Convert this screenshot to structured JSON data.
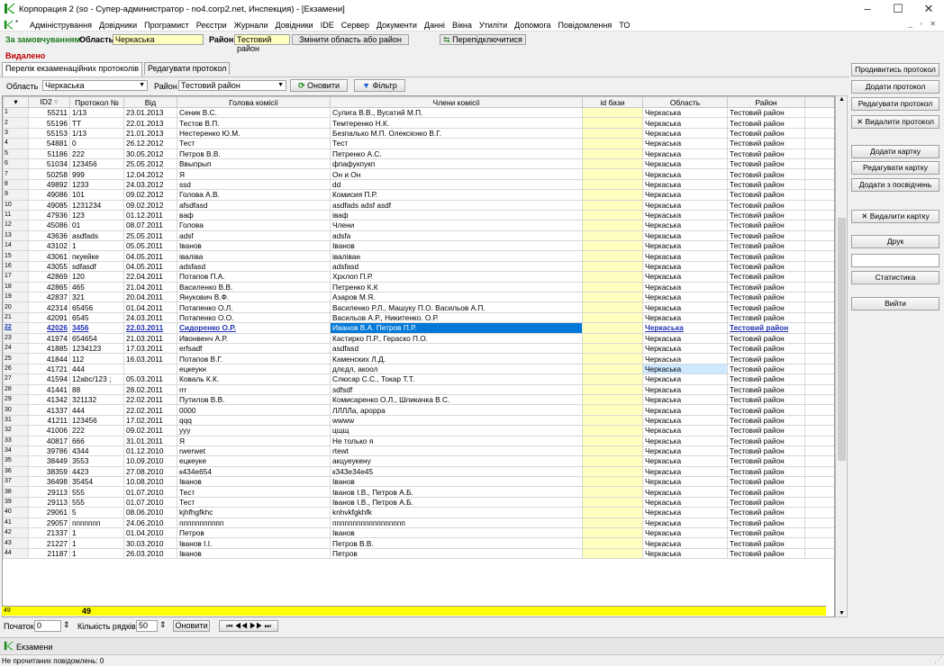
{
  "window": {
    "title": "Корпорация 2 (so - Супер-администратор - no4.corp2.net, Инспекция) - [Екзамени]"
  },
  "menu": [
    "Адміністрування",
    "Довідники",
    "Програмист",
    "Реєстри",
    "Журнали",
    "Довідники",
    "IDE",
    "Сервер",
    "Документи",
    "Данні",
    "Вікна",
    "Утиліти",
    "Допомога",
    "Повідомлення",
    "ТО"
  ],
  "order": {
    "label": "За замовчуванням:",
    "region_label": "Область",
    "region_value": "Черкаська",
    "district_label": "Район",
    "district_value": "Тестовий район",
    "change_btn": "Змінити область або район",
    "reconnect_btn": "Перепідключитися"
  },
  "deleted_label": "Видалено",
  "tabs": [
    "Перелік екзаменаційних протоколів",
    "Редагувати протокол"
  ],
  "filter": {
    "region_label": "Область",
    "region_value": "Черкаська",
    "district_label": "Район",
    "district_value": "Тестовий район",
    "refresh_btn": "Оновити",
    "filter_btn": "Фільтр"
  },
  "columns": [
    "ID2",
    "Протокол №",
    "Від",
    "Голова комісії",
    "Члени комісії",
    "id бази",
    "Область",
    "Район"
  ],
  "rows": [
    [
      "1",
      "55211",
      "1/13",
      "23.01.2013",
      "Сеник В.С.",
      "Сулига В.В., Вусатий М.П.",
      "",
      "Черкаська",
      "Тестовий район"
    ],
    [
      "2",
      "55196",
      "ТТ",
      "22.01.2013",
      "Тестов В.П.",
      "Темтеренко Н.К.",
      "",
      "Черкаська",
      "Тестовий район"
    ],
    [
      "3",
      "55153",
      "1/13",
      "21.01.2013",
      "Нестеренко Ю.М.",
      "Безпалько М.П. Олексієнко В.Г.",
      "",
      "Черкаська",
      "Тестовий район"
    ],
    [
      "4",
      "54881",
      "0",
      "26.12.2012",
      "Тест",
      "Тест",
      "",
      "Черкаська",
      "Тестовий район"
    ],
    [
      "5",
      "51186",
      "222",
      "30.05.2012",
      "Петров В.В.",
      "Петренко А.С.",
      "",
      "Черкаська",
      "Тестовий район"
    ],
    [
      "6",
      "51034",
      "123456",
      "25.05.2012",
      "Ввыпрып",
      "фпафукпукп",
      "",
      "Черкаська",
      "Тестовий район"
    ],
    [
      "7",
      "50258",
      "999",
      "12.04.2012",
      "Я",
      "Он и Он",
      "",
      "Черкаська",
      "Тестовий район"
    ],
    [
      "8",
      "49892",
      "1233",
      "24.03.2012",
      "ssd",
      "dd",
      "",
      "Черкаська",
      "Тестовий район"
    ],
    [
      "9",
      "49086",
      "101",
      "09.02.2012",
      "Голова А.В.",
      "Комисия П.Р.",
      "",
      "Черкаська",
      "Тестовий район"
    ],
    [
      "10",
      "49085",
      "1231234",
      "09.02.2012",
      "afsdfasd",
      "asdfads adsf asdf",
      "",
      "Черкаська",
      "Тестовий район"
    ],
    [
      "11",
      "47936",
      "123",
      "01.12.2011",
      "ваф",
      "іваф",
      "",
      "Черкаська",
      "Тестовий район"
    ],
    [
      "12",
      "45086",
      "01",
      "08.07.2011",
      "Голова",
      "Члени",
      "",
      "Черкаська",
      "Тестовий район"
    ],
    [
      "13",
      "43636",
      "asdfads",
      "25.05.2011",
      "adsf",
      "adsfa",
      "",
      "Черкаська",
      "Тестовий район"
    ],
    [
      "14",
      "43102",
      "1",
      "05.05.2011",
      "Іванов",
      "Іванов",
      "",
      "Черкаська",
      "Тестовий район"
    ],
    [
      "15",
      "43061",
      "пкуейке",
      "04.05.2011",
      "іваліва",
      "іваліван",
      "",
      "Черкаська",
      "Тестовий район"
    ],
    [
      "16",
      "43055",
      "sdfasdf",
      "04.05.2011",
      "adsfasd",
      "adsfasd",
      "",
      "Черкаська",
      "Тестовий район"
    ],
    [
      "17",
      "42869",
      "120",
      "22.04.2011",
      "Потапов П.А.",
      "Хрхлоп П.Р.",
      "",
      "Черкаська",
      "Тестовий район"
    ],
    [
      "18",
      "42865",
      "465",
      "21.04.2011",
      "Василенко В.В.",
      "Петренко К.К",
      "",
      "Черкаська",
      "Тестовий район"
    ],
    [
      "19",
      "42837",
      "321",
      "20.04.2011",
      "Янукович В.Ф.",
      "Азаров М.Я.",
      "",
      "Черкаська",
      "Тестовий район"
    ],
    [
      "20",
      "42314",
      "65456",
      "01.04.2011",
      "Потапенко О.Л.",
      "Василенко Р.Л., Машуку П.О. Васильов А.П.",
      "",
      "Черкаська",
      "Тестовий район"
    ],
    [
      "21",
      "42091",
      "6545",
      "24.03.2011",
      "Потапенко О.О.",
      "Васильов А.Р., Никитенко. О.Р.",
      "",
      "Черкаська",
      "Тестовий район"
    ],
    [
      "22",
      "42026",
      "3456",
      "22.03.2011",
      "Сидоренко О.Р.",
      "Иванов В.А. Петров П.Р.",
      "",
      "Черкаська",
      "Тестовий район"
    ],
    [
      "23",
      "41974",
      "654654",
      "21.03.2011",
      "Ивонвенч А.Р.",
      "Кастирко П.Р., Гераско П.О.",
      "",
      "Черкаська",
      "Тестовий район"
    ],
    [
      "24",
      "41885",
      "1234123",
      "17.03.2011",
      "erfsadf",
      "asdfasd",
      "",
      "Черкаська",
      "Тестовий район"
    ],
    [
      "25",
      "41844",
      "112",
      "16.03.2011",
      "Потапов В.Г.",
      "Каменских Л.Д.",
      "",
      "Черкаська",
      "Тестовий район"
    ],
    [
      "26",
      "41721",
      "444",
      "",
      "ецкеукн",
      "длєдл, акоол",
      "",
      "Черкаська",
      "Тестовий район"
    ],
    [
      "27",
      "41594",
      "12abc/123 ;",
      "05.03.2011",
      "Коваль К.К.",
      "Слюсар С.С., Токар Т.Т.",
      "",
      "Черкаська",
      "Тестовий район"
    ],
    [
      "28",
      "41441",
      "88",
      "28.02.2011",
      "rrr",
      "sdfsdf",
      "",
      "Черкаська",
      "Тестовий район"
    ],
    [
      "29",
      "41342",
      "321132",
      "22.02.2011",
      "Путилов В.В.",
      "Комисаренко О.Л., Шпикачка В.С.",
      "",
      "Черкаська",
      "Тестовий район"
    ],
    [
      "30",
      "41337",
      "444",
      "22.02.2011",
      "0000",
      "ЛЛЛЛа, арорра",
      "",
      "Черкаська",
      "Тестовий район"
    ],
    [
      "31",
      "41211",
      "123456",
      "17.02.2011",
      "qqq",
      "wwww",
      "",
      "Черкаська",
      "Тестовий район"
    ],
    [
      "32",
      "41006",
      "222",
      "09.02.2011",
      "yyy",
      "цщщ",
      "",
      "Черкаська",
      "Тестовий район"
    ],
    [
      "33",
      "40817",
      "666",
      "31.01.2011",
      "Я",
      "Не только я",
      "",
      "Черкаська",
      "Тестовий район"
    ],
    [
      "34",
      "39786",
      "4344",
      "01.12.2010",
      "rwerwet",
      "rtewt",
      "",
      "Черкаська",
      "Тестовий район"
    ],
    [
      "35",
      "38449",
      "3553",
      "10.09.2010",
      "ецкеуке",
      "акцуеукену",
      "",
      "Черкаська",
      "Тестовий район"
    ],
    [
      "36",
      "38359",
      "4423",
      "27.08.2010",
      "к434е654",
      "к343е34е45",
      "",
      "Черкаська",
      "Тестовий район"
    ],
    [
      "37",
      "36498",
      "35454",
      "10.08.2010",
      "Іванов",
      "Іванов",
      "",
      "Черкаська",
      "Тестовий район"
    ],
    [
      "38",
      "29113",
      "555",
      "01.07.2010",
      "Тест",
      "Іванов І.В., Петров А.Б.",
      "",
      "Черкаська",
      "Тестовий район"
    ],
    [
      "39",
      "29113",
      "555",
      "01.07.2010",
      "Тест",
      "Іванов І.В., Петров А.Б.",
      "",
      "Черкаська",
      "Тестовий район"
    ],
    [
      "40",
      "29061",
      "5",
      "08.06.2010",
      "kjhfhgfkhc",
      "knhvkfgkhfk",
      "",
      "Черкаська",
      "Тестовий район"
    ],
    [
      "41",
      "29057",
      "ппппппп",
      "24.06.2010",
      "ппппппппппп",
      "пппппппппппппппппп",
      "",
      "Черкаська",
      "Тестовий район"
    ],
    [
      "42",
      "21337",
      "1",
      "01.04.2010",
      "Петров",
      "Іванов",
      "",
      "Черкаська",
      "Тестовий район"
    ],
    [
      "43",
      "21227",
      "1",
      "30.03.2010",
      "Іванов І.І.",
      "Петров В.В.",
      "",
      "Черкаська",
      "Тестовий район"
    ],
    [
      "44",
      "21187",
      "1",
      "26.03.2010",
      "Іванов",
      "Петров",
      "",
      "Черкаська",
      "Тестовий район"
    ]
  ],
  "footer": {
    "row_num": "49",
    "count": "49"
  },
  "pager": {
    "start_label": "Початок",
    "start_value": "0",
    "count_label": "Кількість рядків",
    "count_value": "50",
    "refresh": "Оновити",
    "nav": "⏮ ◀◀ ▶▶ ⏭"
  },
  "side_buttons": [
    "Продивитись протокол",
    "Додати протокол",
    "Редагувати протокол",
    "✕ Видалити протокол",
    "Додати картку",
    "Редагувати картку",
    "Додати з посвідчень",
    "✕ Видалити картку",
    "Друк",
    "Статистика",
    "Вийти"
  ],
  "taskbar": {
    "item": "Екзамени"
  },
  "status": "Не прочитаних повідомлень: 0",
  "colors": {
    "accent": "#0078d7",
    "yellow": "#ffffc0",
    "total": "#ffff00",
    "logo": "#3cb03c"
  }
}
